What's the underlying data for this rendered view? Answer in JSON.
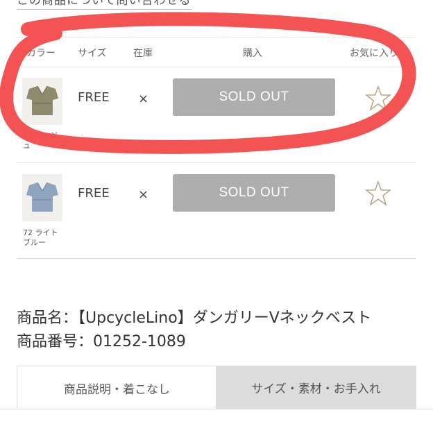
{
  "top_link": "この商品について問い合わせる",
  "table": {
    "headers": {
      "color": "カラー",
      "size": "サイズ",
      "stock": "在庫",
      "buy": "購入",
      "favorite": "お気に入り"
    },
    "rows": [
      {
        "color": "21 ベージュ",
        "color_l1": "21 ベージ",
        "color_l2": "ュ",
        "size": "FREE",
        "stock": "×",
        "buy": "SOLD OUT"
      },
      {
        "color": "72 ライトブルー",
        "color_l1": "72 ライト",
        "color_l2": "ブルー",
        "size": "FREE",
        "stock": "×",
        "buy": "SOLD OUT"
      }
    ]
  },
  "product": {
    "name_line": "商品名：【UpcycleLino】ダンガリーVネックベスト",
    "number_line": "商品番号：01252-1089"
  },
  "tabs": {
    "description": "商品説明・着こなし",
    "size_material": "サイズ・素材・お手入れ"
  },
  "colors": {
    "annotation": "#f24a4a",
    "button_bg": "#adadad",
    "star": "#b8a88a"
  },
  "icons": {
    "favorite": "star-outline-icon"
  }
}
